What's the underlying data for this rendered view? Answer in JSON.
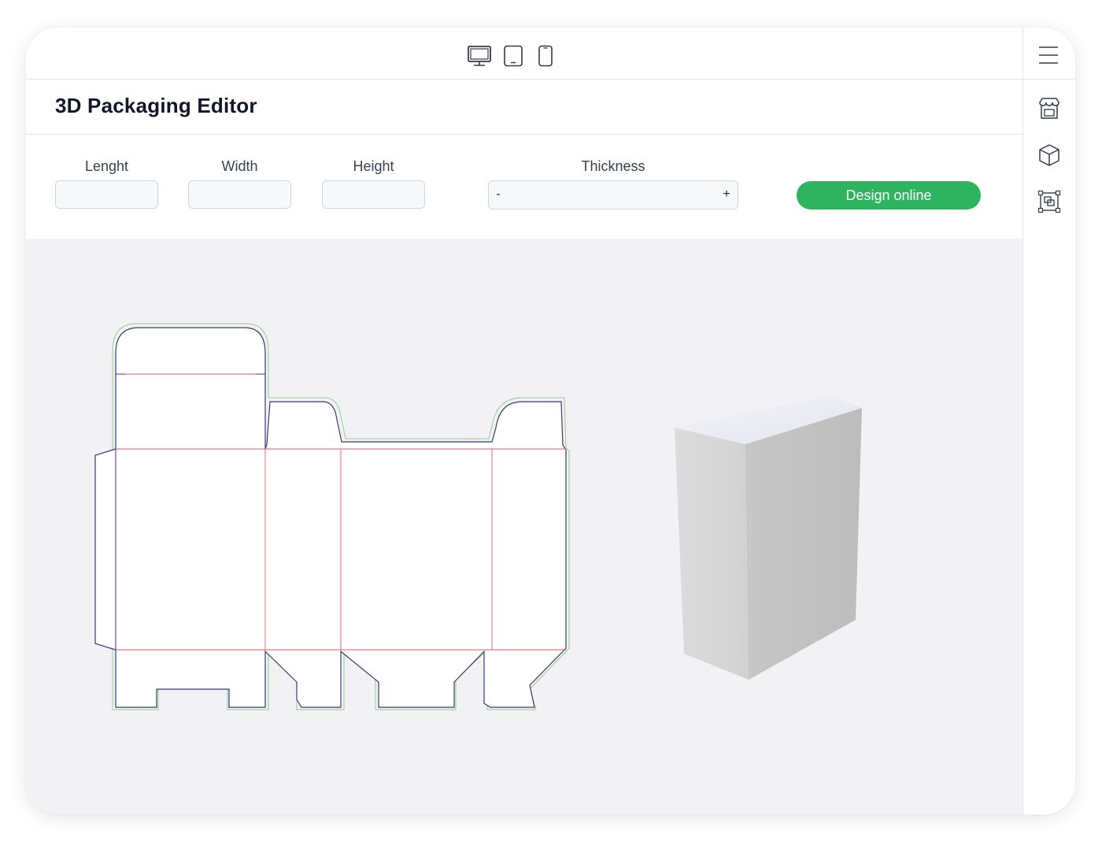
{
  "header": {
    "title": "3D Packaging Editor",
    "device_icons": [
      "desktop-icon",
      "tablet-icon",
      "mobile-icon"
    ]
  },
  "controls": {
    "length": {
      "label": "Lenght",
      "value": ""
    },
    "width": {
      "label": "Width",
      "value": ""
    },
    "height": {
      "label": "Height",
      "value": ""
    },
    "thickness": {
      "label": "Thickness",
      "minus": "-",
      "plus": "+"
    },
    "design_button": "Design online"
  },
  "sidebar": {
    "icons": [
      "menu-icon",
      "store-icon",
      "cube-icon",
      "dieline-icon"
    ]
  },
  "colors": {
    "accent": "#2eb45e",
    "cut_line": "#3a3a78",
    "fold_line": "#e35a6e",
    "bleed_line": "#7dc86e",
    "canvas_bg": "#f2f2f4"
  }
}
